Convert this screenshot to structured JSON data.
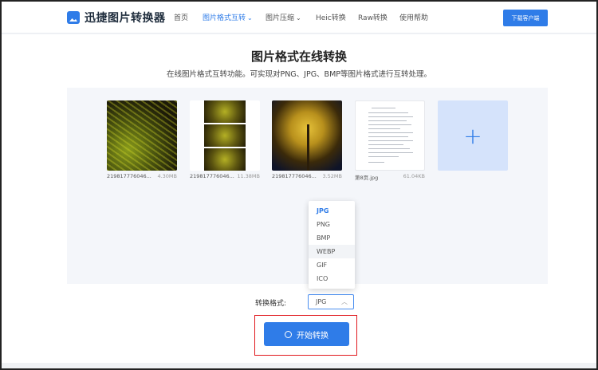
{
  "header": {
    "logo": "迅捷图片转换器",
    "nav": [
      {
        "label": "首页",
        "active": false
      },
      {
        "label": "图片格式互转",
        "active": true,
        "has_caret": true
      },
      {
        "label": "图片压缩",
        "active": false,
        "has_caret": true
      },
      {
        "label": "Heic转换",
        "active": false
      },
      {
        "label": "Raw转换",
        "active": false
      },
      {
        "label": "使用帮助",
        "active": false
      }
    ],
    "download_button": "下载客户端"
  },
  "main": {
    "title": "图片格式在线转换",
    "subtitle": "在线图片格式互转功能。可实现对PNG、JPG、BMP等图片格式进行互转处理。"
  },
  "files": [
    {
      "name": "219817776046...",
      "size": "4.30MB"
    },
    {
      "name": "219817776046...",
      "size": "11.38MB"
    },
    {
      "name": "219817776046...",
      "size": "3.52MB"
    },
    {
      "name": "第8页.jpg",
      "size": "61.04KB"
    }
  ],
  "add_tile_icon": "plus-icon",
  "format": {
    "label": "转换格式:",
    "selected": "JPG",
    "options": [
      "JPG",
      "PNG",
      "BMP",
      "WEBP",
      "GIF",
      "ICO"
    ],
    "hovered": "WEBP"
  },
  "start_button": "开始转换",
  "colors": {
    "accent": "#2f7ce8",
    "highlight_border": "#e0191e"
  }
}
